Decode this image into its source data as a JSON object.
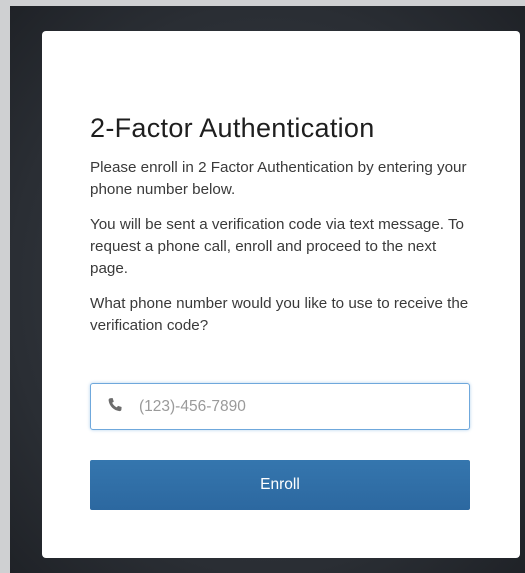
{
  "card": {
    "title": "2-Factor Authentication",
    "paragraphs": [
      "Please enroll in 2 Factor Authentication by entering your phone number below.",
      "You will be sent a verification code via text message. To request a phone call, enroll and proceed to the next page.",
      "What phone number would you like to use to receive the verification code?"
    ],
    "phone_field": {
      "icon": "phone-icon",
      "value": "",
      "placeholder": "(123)-456-7890"
    },
    "enroll_label": "Enroll"
  },
  "colors": {
    "button": "#2f6fa8",
    "input_border": "#6fa8dc",
    "background": "#2b2f36"
  }
}
